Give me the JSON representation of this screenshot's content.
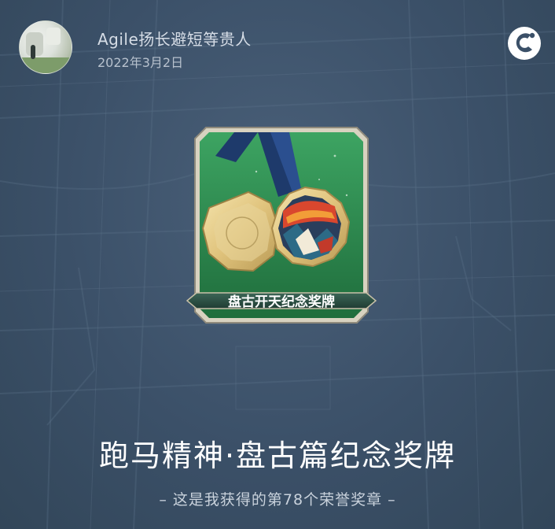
{
  "header": {
    "user_name": "Agile扬长避短等贵人",
    "post_date": "2022年3月2日"
  },
  "medal": {
    "ribbon_label": "盘古开天纪念奖牌",
    "title": "跑马精神·盘古篇纪念奖牌",
    "subtitle": "– 这是我获得的第78个荣誉奖章 –"
  },
  "icons": {
    "app_logo": "app-logo-icon",
    "avatar": "avatar-image"
  },
  "colors": {
    "background": "#3b5068",
    "card_green": "#2f8a4d",
    "card_frame": "#c9c2ae",
    "ribbon_dark": "#2a4a3f",
    "medal_gold": "#e4cf92",
    "title_text": "#ffffff"
  }
}
